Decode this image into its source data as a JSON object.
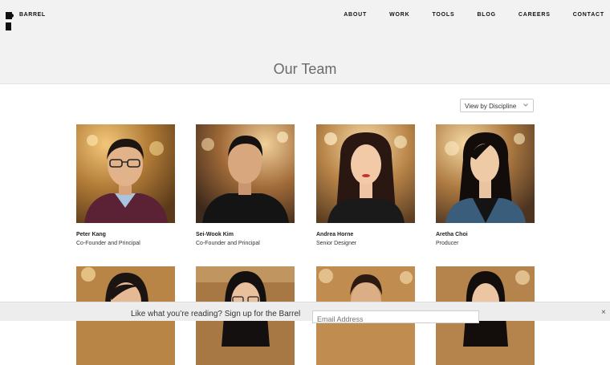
{
  "brand": {
    "name": "BARREL"
  },
  "nav": {
    "items": [
      {
        "label": "ABOUT"
      },
      {
        "label": "WORK"
      },
      {
        "label": "TOOLS"
      },
      {
        "label": "BLOG"
      },
      {
        "label": "CAREERS"
      },
      {
        "label": "CONTACT"
      }
    ]
  },
  "page": {
    "title": "Our Team"
  },
  "filter": {
    "selected": "View by Discipline",
    "icon": "chevron-down-icon"
  },
  "team": [
    {
      "name": "Peter Kang",
      "role": "Co-Founder and Principal"
    },
    {
      "name": "Sei-Wook Kim",
      "role": "Co-Founder and Principal"
    },
    {
      "name": "Andrea Horne",
      "role": "Senior Designer"
    },
    {
      "name": "Aretha Choi",
      "role": "Producer"
    }
  ],
  "newsletter": {
    "text": "Like what you’re reading? Sign up for the Barrel",
    "placeholder": "Email Address",
    "close": "×"
  },
  "colors": {
    "header_bg": "#f2f2f2",
    "newsletter_bg": "#ededed",
    "photo_bg": "#c48a3e"
  }
}
